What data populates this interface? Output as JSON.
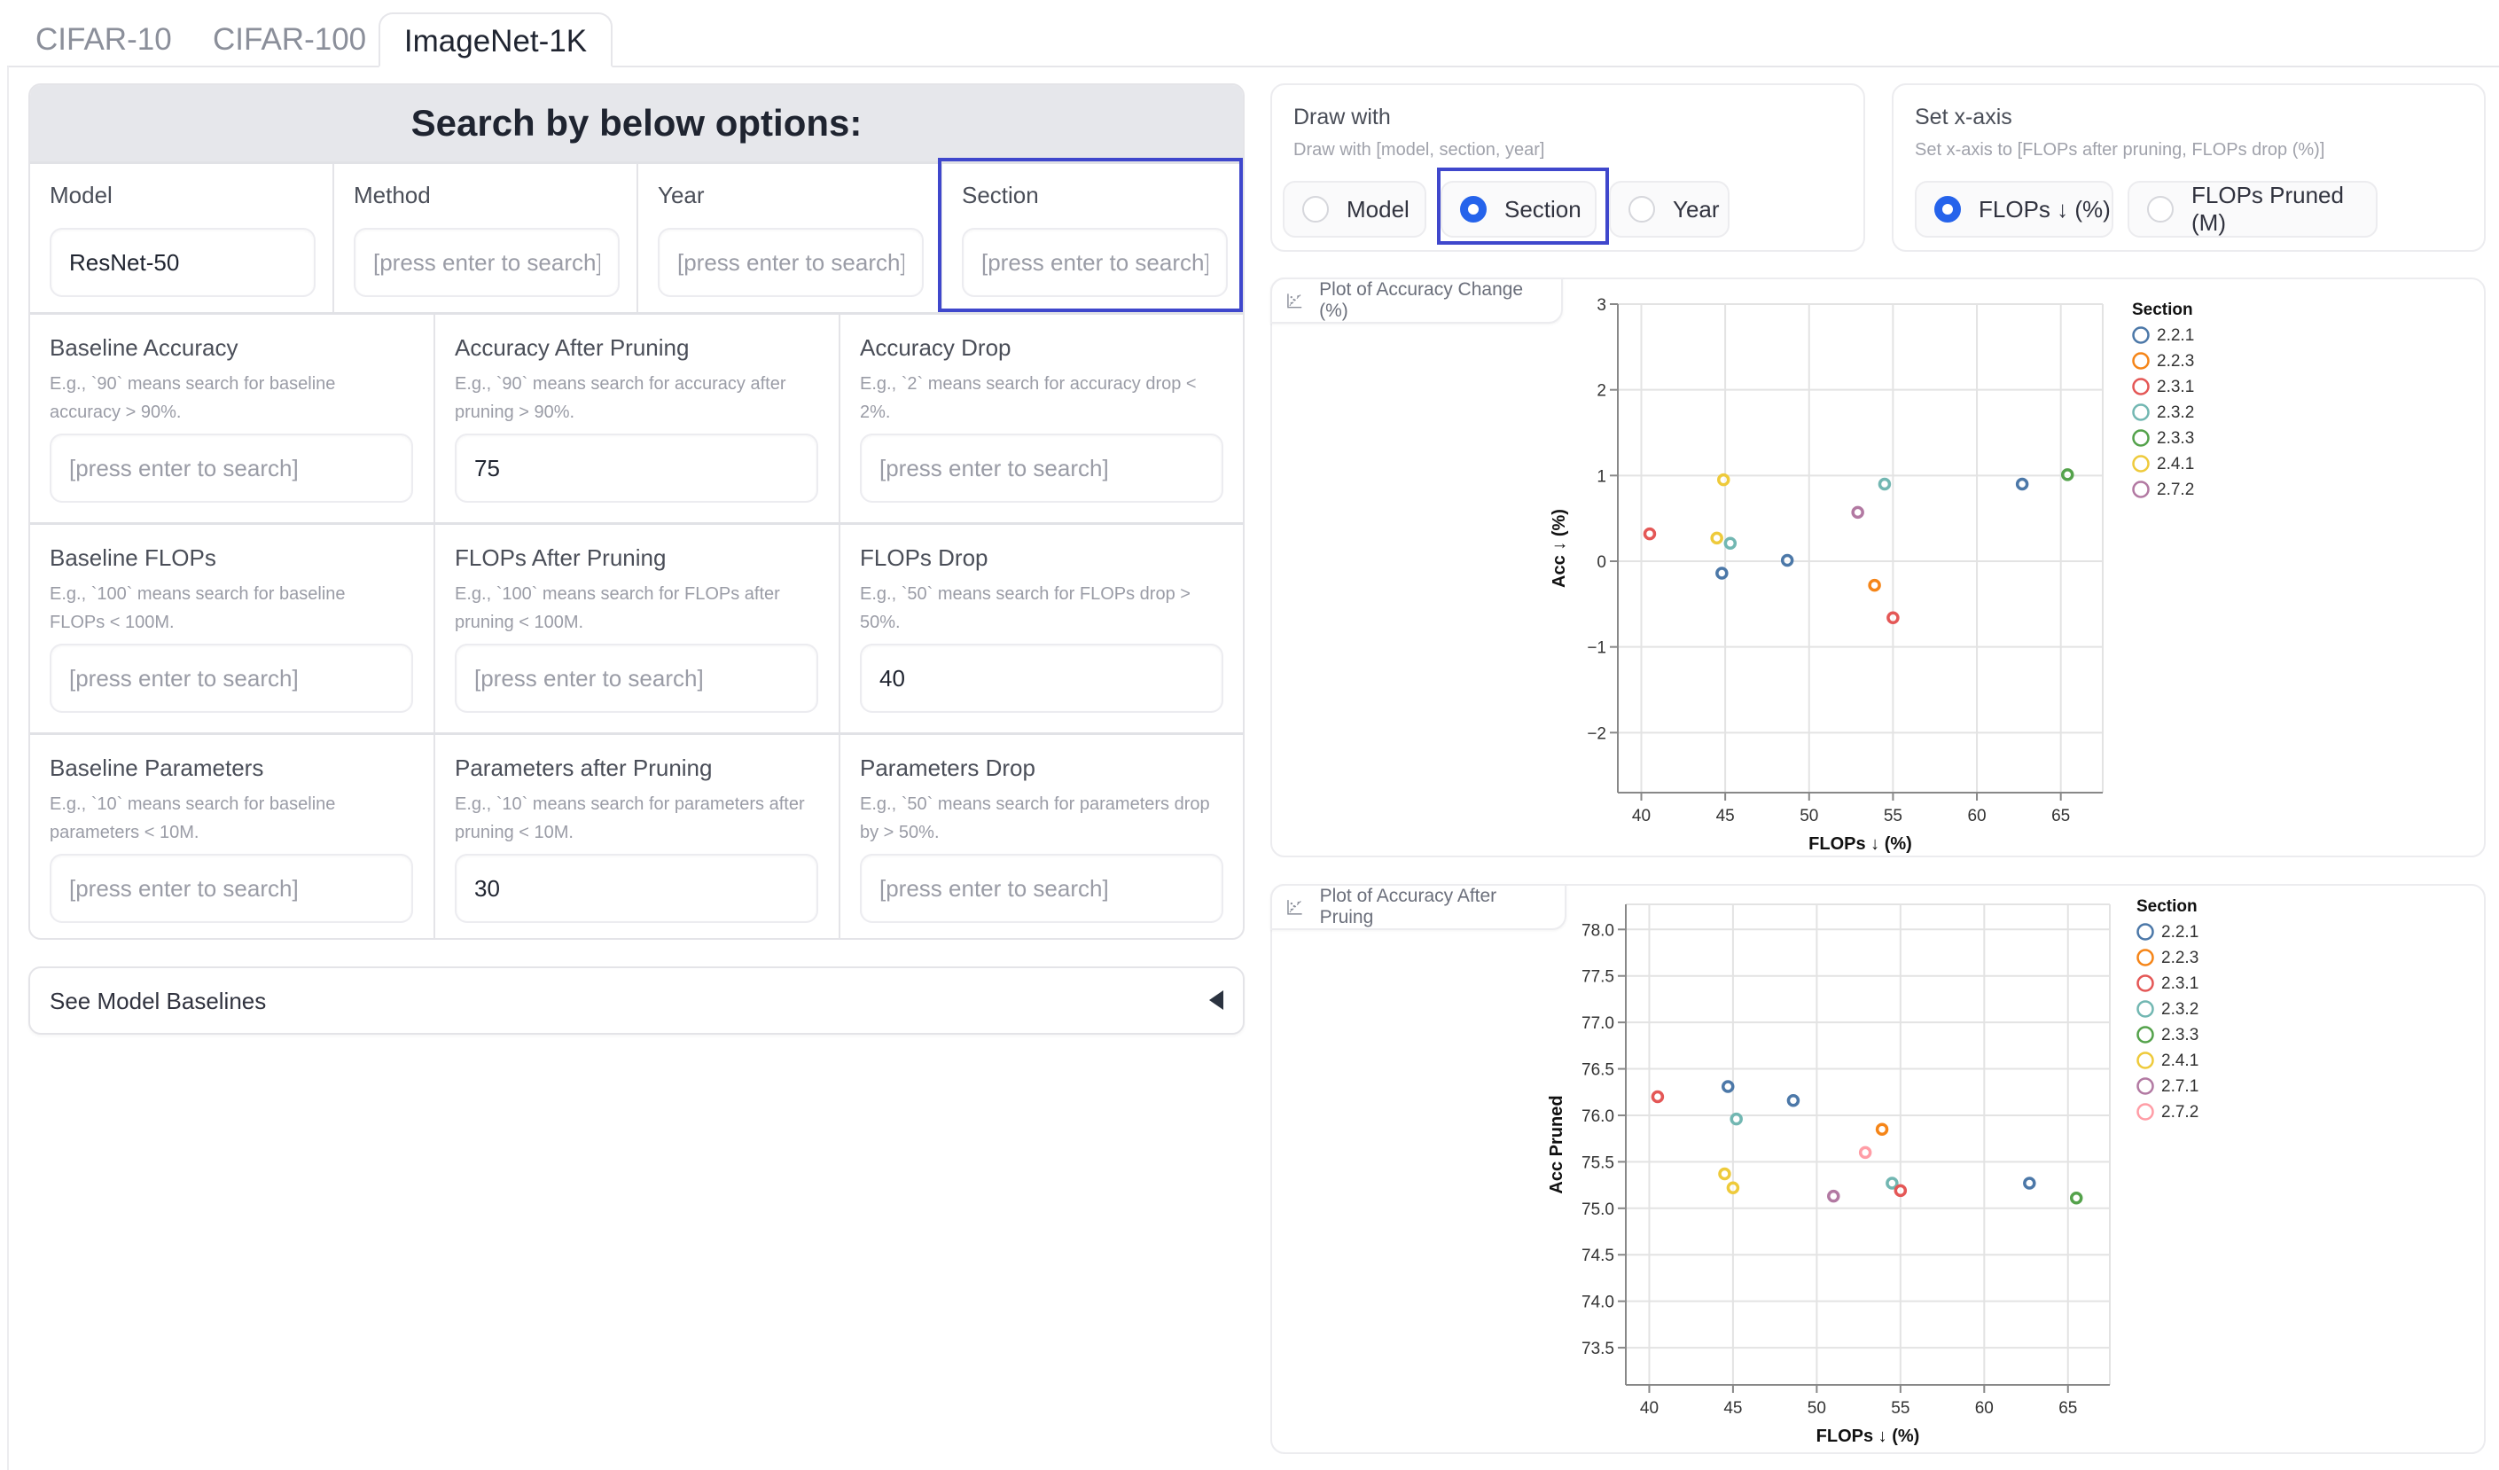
{
  "tabs": [
    {
      "label": "CIFAR-10",
      "active": false
    },
    {
      "label": "CIFAR-100",
      "active": false
    },
    {
      "label": "ImageNet-1K",
      "active": true
    }
  ],
  "search": {
    "header": "Search by below options:",
    "top_fields": [
      {
        "label": "Model",
        "value": "ResNet-50",
        "placeholder": "[press enter to search]"
      },
      {
        "label": "Method",
        "value": "",
        "placeholder": "[press enter to search]"
      },
      {
        "label": "Year",
        "value": "",
        "placeholder": "[press enter to search]"
      },
      {
        "label": "Section",
        "value": "",
        "placeholder": "[press enter to search]"
      }
    ],
    "rows": [
      [
        {
          "label": "Baseline Accuracy",
          "help": "E.g., `90` means search for baseline accuracy > 90%.",
          "value": "",
          "placeholder": "[press enter to search]"
        },
        {
          "label": "Accuracy After Pruning",
          "help": "E.g., `90` means search for accuracy after pruning > 90%.",
          "value": "75",
          "placeholder": "[press enter to search]"
        },
        {
          "label": "Accuracy Drop",
          "help": "E.g., `2` means search for accuracy drop < 2%.",
          "value": "",
          "placeholder": "[press enter to search]"
        }
      ],
      [
        {
          "label": "Baseline FLOPs",
          "help": "E.g., `100` means search for baseline FLOPs < 100M.",
          "value": "",
          "placeholder": "[press enter to search]"
        },
        {
          "label": "FLOPs After Pruning",
          "help": "E.g., `100` means search for FLOPs after pruning < 100M.",
          "value": "",
          "placeholder": "[press enter to search]"
        },
        {
          "label": "FLOPs Drop",
          "help": "E.g., `50` means search for FLOPs drop > 50%.",
          "value": "40",
          "placeholder": "[press enter to search]"
        }
      ],
      [
        {
          "label": "Baseline Parameters",
          "help": "E.g., `10` means search for baseline parameters < 10M.",
          "value": "",
          "placeholder": "[press enter to search]"
        },
        {
          "label": "Parameters after Pruning",
          "help": "E.g., `10` means search for parameters after pruning < 10M.",
          "value": "30",
          "placeholder": "[press enter to search]"
        },
        {
          "label": "Parameters Drop",
          "help": "E.g., `50` means search for parameters drop by > 50%.",
          "value": "",
          "placeholder": "[press enter to search]"
        }
      ]
    ],
    "baselines_label": "See Model Baselines"
  },
  "draw_with": {
    "title": "Draw with",
    "subtitle": "Draw with [model, section, year]",
    "options": [
      "Model",
      "Section",
      "Year"
    ],
    "selected": "Section"
  },
  "x_axis": {
    "title": "Set x-axis",
    "subtitle": "Set x-axis to [FLOPs after pruning, FLOPs drop (%)]",
    "options": [
      "FLOPs ↓ (%)",
      "FLOPs Pruned (M)"
    ],
    "selected": "FLOPs ↓ (%)"
  },
  "colors": {
    "accent": "#2563eb",
    "highlight": "#3f47cc",
    "section_palette": {
      "2.2.1": "#4c78a8",
      "2.2.3": "#f58518",
      "2.3.1": "#e45756",
      "2.3.2": "#72b7b2",
      "2.3.3": "#54a24b",
      "2.4.1": "#eeca3b",
      "2.7.1": "#b279a2",
      "2.7.2": "#ff9da6"
    }
  },
  "chart_data": [
    {
      "type": "scatter",
      "title": "Plot of Accuracy Change (%)",
      "xlabel": "FLOPs ↓ (%)",
      "ylabel": "Acc ↓ (%)",
      "xlim": [
        38.6,
        67.5
      ],
      "ylim": [
        -2.7,
        3.0
      ],
      "xticks": [
        40,
        45,
        50,
        55,
        60,
        65
      ],
      "yticks": [
        -2,
        -1,
        0,
        1,
        2,
        3
      ],
      "grid": true,
      "legend": {
        "title": "Section",
        "position": "right",
        "entries": [
          {
            "label": "2.2.1",
            "color": "#4c78a8"
          },
          {
            "label": "2.2.3",
            "color": "#f58518"
          },
          {
            "label": "2.3.1",
            "color": "#e45756"
          },
          {
            "label": "2.3.2",
            "color": "#72b7b2"
          },
          {
            "label": "2.3.3",
            "color": "#54a24b"
          },
          {
            "label": "2.4.1",
            "color": "#eeca3b"
          },
          {
            "label": "2.7.2",
            "color": "#b279a2"
          }
        ]
      },
      "points": [
        {
          "section": "2.3.1",
          "x": 40.5,
          "y": 0.32
        },
        {
          "section": "2.4.1",
          "x": 44.5,
          "y": 0.27
        },
        {
          "section": "2.4.1",
          "x": 44.9,
          "y": 0.95
        },
        {
          "section": "2.3.2",
          "x": 45.3,
          "y": 0.21
        },
        {
          "section": "2.2.1",
          "x": 44.8,
          "y": -0.14
        },
        {
          "section": "2.2.1",
          "x": 48.7,
          "y": 0.01
        },
        {
          "section": "2.7.2",
          "x": 52.9,
          "y": 0.57
        },
        {
          "section": "2.2.3",
          "x": 53.9,
          "y": -0.28
        },
        {
          "section": "2.3.2",
          "x": 54.5,
          "y": 0.9
        },
        {
          "section": "2.3.1",
          "x": 55.0,
          "y": -0.66
        },
        {
          "section": "2.2.1",
          "x": 62.7,
          "y": 0.9
        },
        {
          "section": "2.3.3",
          "x": 65.4,
          "y": 1.01
        }
      ]
    },
    {
      "type": "scatter",
      "title": "Plot of Accuracy After Pruing",
      "xlabel": "FLOPs ↓ (%)",
      "ylabel": "Acc Pruned",
      "xlim": [
        38.6,
        67.5
      ],
      "ylim": [
        73.1,
        78.27
      ],
      "xticks": [
        40,
        45,
        50,
        55,
        60,
        65
      ],
      "yticks": [
        73.5,
        74.0,
        74.5,
        75.0,
        75.5,
        76.0,
        76.5,
        77.0,
        77.5,
        78.0
      ],
      "grid": true,
      "legend": {
        "title": "Section",
        "position": "right",
        "entries": [
          {
            "label": "2.2.1",
            "color": "#4c78a8"
          },
          {
            "label": "2.2.3",
            "color": "#f58518"
          },
          {
            "label": "2.3.1",
            "color": "#e45756"
          },
          {
            "label": "2.3.2",
            "color": "#72b7b2"
          },
          {
            "label": "2.3.3",
            "color": "#54a24b"
          },
          {
            "label": "2.4.1",
            "color": "#eeca3b"
          },
          {
            "label": "2.7.1",
            "color": "#b279a2"
          },
          {
            "label": "2.7.2",
            "color": "#ff9da6"
          }
        ]
      },
      "points": [
        {
          "section": "2.3.1",
          "x": 40.5,
          "y": 76.2
        },
        {
          "section": "2.2.1",
          "x": 44.7,
          "y": 76.31
        },
        {
          "section": "2.2.1",
          "x": 48.6,
          "y": 76.16
        },
        {
          "section": "2.3.2",
          "x": 45.2,
          "y": 75.96
        },
        {
          "section": "2.2.3",
          "x": 53.9,
          "y": 75.85
        },
        {
          "section": "2.7.2",
          "x": 52.9,
          "y": 75.6
        },
        {
          "section": "2.4.1",
          "x": 44.5,
          "y": 75.37
        },
        {
          "section": "2.4.1",
          "x": 45.0,
          "y": 75.22
        },
        {
          "section": "2.7.1",
          "x": 51.0,
          "y": 75.13
        },
        {
          "section": "2.3.2",
          "x": 54.5,
          "y": 75.27
        },
        {
          "section": "2.3.1",
          "x": 55.0,
          "y": 75.19
        },
        {
          "section": "2.2.1",
          "x": 62.7,
          "y": 75.27
        },
        {
          "section": "2.3.3",
          "x": 65.5,
          "y": 75.11
        }
      ]
    }
  ]
}
